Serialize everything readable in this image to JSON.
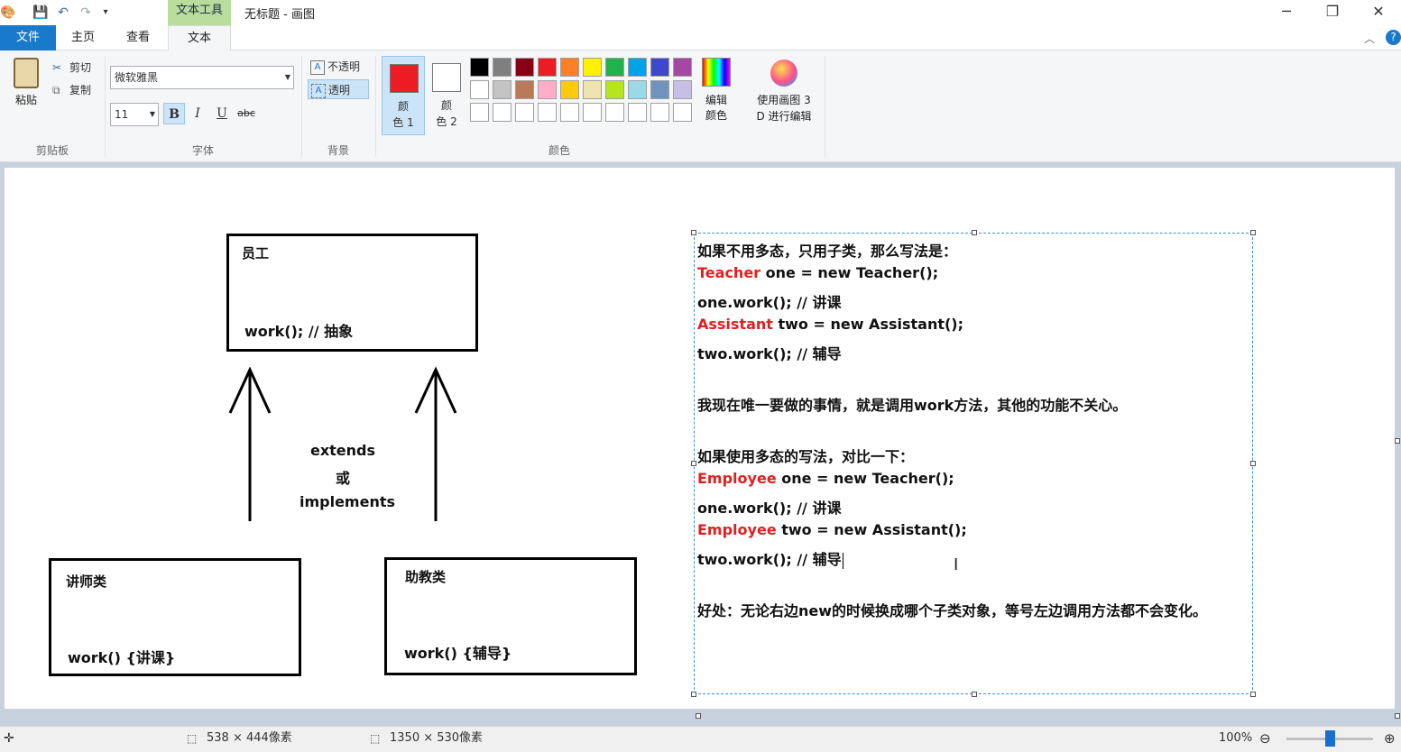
{
  "titlebar": {
    "context_tab": "文本工具",
    "title": "无标题 - 画图",
    "minimize": "─",
    "restore": "❐",
    "close": "✕"
  },
  "tabs": {
    "file": "文件",
    "home": "主页",
    "view": "查看",
    "text": "文本"
  },
  "ribbon": {
    "clipboard": {
      "paste": "粘贴",
      "cut": "剪切",
      "copy": "复制",
      "group": "剪贴板"
    },
    "font": {
      "family": "微软雅黑",
      "size": "11",
      "bold": "B",
      "italic": "I",
      "underline": "U",
      "strike": "abc",
      "group": "字体"
    },
    "background": {
      "opaque": "不透明",
      "transparent": "透明",
      "group": "背景"
    },
    "colors": {
      "color1_label": "颜\n色 1",
      "color1_a": "颜",
      "color1_b": "色 1",
      "color2_a": "颜",
      "color2_b": "色 2",
      "color1_value": "#ed1c24",
      "color2_value": "#ffffff",
      "edit_a": "编辑",
      "edit_b": "颜色",
      "group": "颜色",
      "palette_row1": [
        "#000000",
        "#7f7f7f",
        "#880015",
        "#ed1c24",
        "#ff7f27",
        "#fff200",
        "#22b14c",
        "#00a2e8",
        "#3f48cc",
        "#a349a4"
      ],
      "palette_row2": [
        "#ffffff",
        "#c3c3c3",
        "#b97a57",
        "#ffaec9",
        "#ffc90e",
        "#efe4b0",
        "#b5e61d",
        "#99d9ea",
        "#7092be",
        "#c8bfe7"
      ]
    },
    "paint3d": {
      "line1": "使用画图 3",
      "line2": "D 进行编辑"
    }
  },
  "diagram": {
    "parent_title": "员工",
    "parent_method": "work(); // 抽象",
    "middle_1": "extends",
    "middle_2": "或",
    "middle_3": "implements",
    "left_title": "讲师类",
    "left_method": "work() {讲课}",
    "right_title": "助教类",
    "right_method": "work() {辅导}"
  },
  "text": {
    "l1": "如果不用多态，只用子类，那么写法是：",
    "l2_kw": "Teacher",
    "l2_rest": " one = new Teacher();",
    "l3": "one.work(); // 讲课",
    "l4_kw": "Assistant",
    "l4_rest": " two = new Assistant();",
    "l5": "two.work(); // 辅导",
    "l6": "我现在唯一要做的事情，就是调用work方法，其他的功能不关心。",
    "l7": "如果使用多态的写法，对比一下：",
    "l8_kw": "Employee",
    "l8_rest": " one = new Teacher();",
    "l9": "one.work(); // 讲课",
    "l10_kw": "Employee",
    "l10_rest": " two = new Assistant();",
    "l11": "two.work(); // 辅导",
    "l12": "好处：无论右边new的时候换成哪个子类对象，等号左边调用方法都不会变化。"
  },
  "status": {
    "selection_size": "538 × 444像素",
    "canvas_size": "1350 × 530像素",
    "zoom": "100%",
    "zoom_level": 0.5
  }
}
